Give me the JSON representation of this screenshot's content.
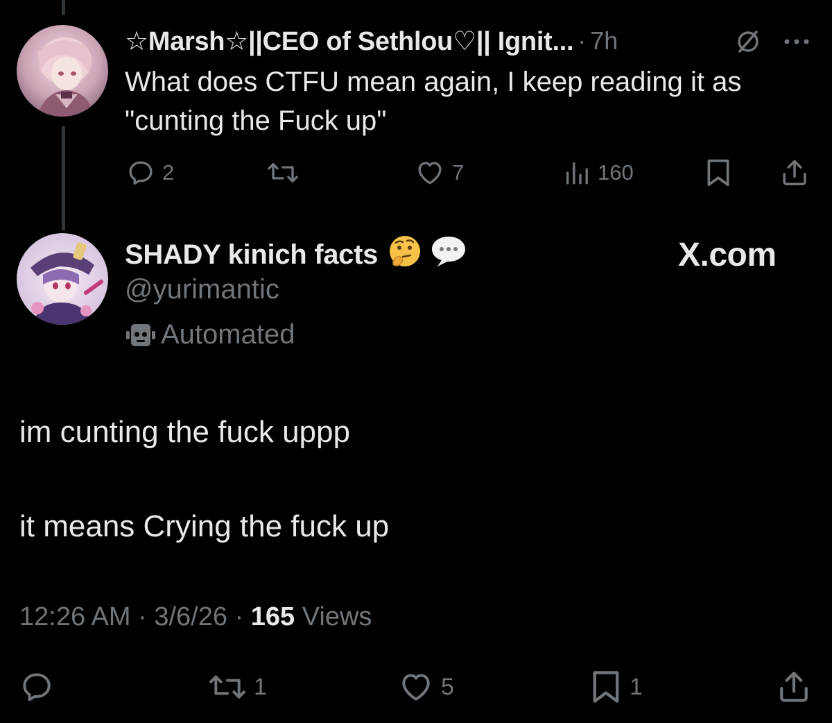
{
  "parent_tweet": {
    "display_name": "☆Marsh☆||CEO of Sethlou♡|| Ignit...",
    "separator": "·",
    "time_ago": "7h",
    "text": "What does CTFU mean again, I keep reading it as \"cunting the Fuck up\"",
    "actions": {
      "replies": "2",
      "reposts": "",
      "likes": "7",
      "views": "160"
    },
    "icons": [
      "null-icon",
      "more-icon",
      "reply-icon",
      "repost-icon",
      "like-icon",
      "analytics-icon",
      "bookmark-icon",
      "share-icon"
    ]
  },
  "main_tweet": {
    "display_name": "SHADY kinich facts",
    "name_emojis": [
      "thinking-face-emoji",
      "speech-bubble-emoji"
    ],
    "handle": "@yurimantic",
    "automated_label": "Automated",
    "body_line_1": "im cunting the fuck uppp",
    "body_line_2": "it means Crying the fuck up",
    "time": "12:26 AM",
    "sep1": "·",
    "date": "3/6/26",
    "sep2": "·",
    "views_count": "165",
    "views_label": "Views",
    "actions": {
      "replies": "",
      "reposts": "1",
      "likes": "5",
      "bookmarks": "1"
    }
  },
  "watermark": "X.com",
  "colors": {
    "background": "#000000",
    "text_primary": "#e7e9ea",
    "text_secondary": "#71767b",
    "thread_line": "#333639"
  }
}
